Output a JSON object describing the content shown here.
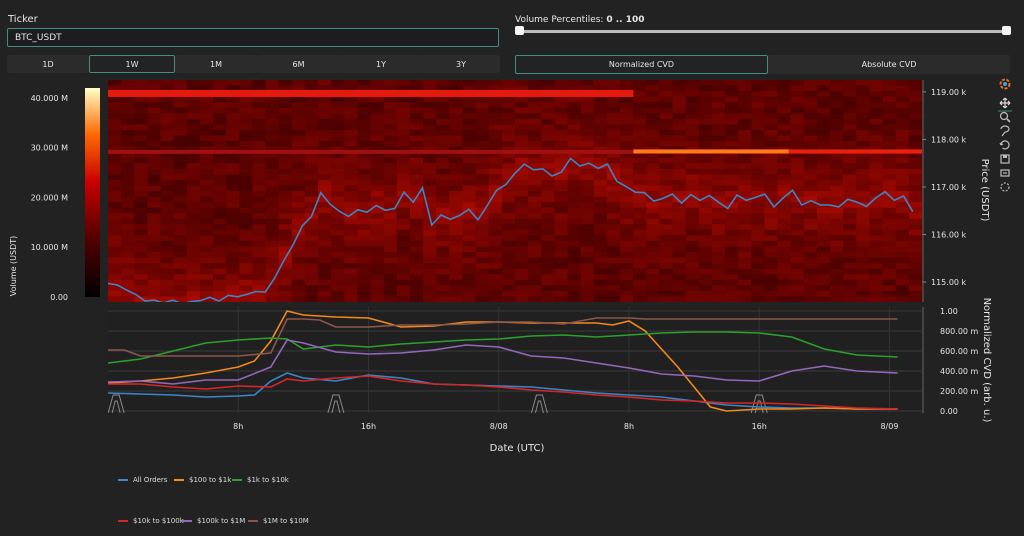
{
  "ticker": {
    "label": "Ticker",
    "value": "BTC_USDT"
  },
  "volume_filter": {
    "label": "Volume Percentiles:",
    "value": "0 .. 100",
    "low": 0,
    "high": 100
  },
  "timeframes": [
    {
      "label": "1D",
      "active": false
    },
    {
      "label": "1W",
      "active": true
    },
    {
      "label": "1M",
      "active": false
    },
    {
      "label": "6M",
      "active": false
    },
    {
      "label": "1Y",
      "active": false
    },
    {
      "label": "3Y",
      "active": false
    }
  ],
  "cvd_modes": [
    {
      "label": "Normalized CVD",
      "active": true
    },
    {
      "label": "Absolute CVD",
      "active": false
    }
  ],
  "toolbar_icons": [
    "plotly-logo-icon",
    "pan-icon",
    "zoom-icon",
    "lasso-icon",
    "reset-axes-icon",
    "download-icon",
    "autoscale-icon",
    "spike-lines-icon"
  ],
  "colors": {
    "accent": "#3f8e82",
    "price_line": "#3a86c8"
  },
  "chart_data": [
    {
      "type": "heatmap",
      "title": "",
      "xlabel": "",
      "ylabel": "Price (USDT)",
      "colorbar_title": "Volume (USDT)",
      "colorbar_ticks": [
        "40.000 M",
        "30.000 M",
        "20.000 M",
        "10.000 M",
        "0.00"
      ],
      "colorbar_range": [
        0,
        42000000
      ],
      "y_ticks": [
        "119.00 k",
        "118.00 k",
        "117.00 k",
        "116.00 k",
        "115.00 k"
      ],
      "y_tick_values": [
        119000,
        118000,
        117000,
        116000,
        115000
      ],
      "ylim": [
        114580,
        119250
      ],
      "x_hours": [
        0,
        44
      ],
      "price_series": {
        "hours": [
          0,
          0.5,
          1,
          1.5,
          2,
          2.5,
          3,
          3.5,
          4,
          4.5,
          5,
          5.5,
          6,
          6.5,
          7,
          7.5,
          8,
          8.5,
          9,
          9.5,
          10,
          10.5,
          11,
          11.5,
          12,
          12.5,
          13,
          13.5,
          14,
          14.5,
          15,
          15.5,
          16,
          16.5,
          17,
          17.5,
          18,
          18.5,
          19,
          19.5,
          20,
          20.5,
          21,
          21.5,
          22,
          22.5,
          23,
          23.5,
          24,
          24.5,
          25,
          25.5,
          26,
          26.5,
          27,
          27.5,
          28,
          28.5,
          29,
          29.5,
          30,
          30.5,
          31,
          31.5,
          32,
          32.5,
          33,
          33.5,
          34,
          34.5,
          35,
          35.5,
          36,
          36.5,
          37,
          37.5,
          38,
          38.5,
          39,
          39.5,
          40,
          40.5,
          41,
          41.5,
          42,
          42.5,
          43,
          43.5
        ],
        "values": [
          114970,
          114940,
          114830,
          114740,
          114600,
          114620,
          114560,
          114620,
          114540,
          114590,
          114610,
          114680,
          114600,
          114720,
          114690,
          114740,
          114800,
          114790,
          115080,
          115450,
          115780,
          116180,
          116380,
          116880,
          116640,
          116490,
          116380,
          116520,
          116470,
          116610,
          116510,
          116550,
          116890,
          116680,
          116980,
          116200,
          116410,
          116320,
          116400,
          116530,
          116310,
          116610,
          116930,
          117050,
          117290,
          117480,
          117360,
          117380,
          117230,
          117310,
          117600,
          117440,
          117500,
          117390,
          117480,
          117120,
          117010,
          116890,
          116880,
          116700,
          116760,
          116850,
          116660,
          116840,
          116720,
          116820,
          116680,
          116550,
          116830,
          116720,
          116780,
          116850,
          116580,
          116770,
          116930,
          116620,
          116710,
          116620,
          116620,
          116580,
          116740,
          116680,
          116590,
          116770,
          116900,
          116720,
          116810,
          116480
        ]
      }
    },
    {
      "type": "line",
      "title": "",
      "xlabel": "Date (UTC)",
      "ylabel": "Normalized CVD (arb. u.)",
      "x_ticks": [
        "8h",
        "16h",
        "8/08",
        "8h",
        "16h",
        "8/09"
      ],
      "x_tick_hours": [
        8,
        16,
        24,
        32,
        40,
        48
      ],
      "x_hours": [
        0,
        50
      ],
      "y_ticks": [
        "1.00",
        "800.00 m",
        "600.00 m",
        "400.00 m",
        "200.00 m",
        "0.00"
      ],
      "y_tick_values": [
        1.0,
        0.8,
        0.6,
        0.4,
        0.2,
        0.0
      ],
      "ylim": [
        -0.02,
        1.04
      ],
      "grid": true,
      "legend_position": "bottom",
      "series": [
        {
          "name": "All Orders",
          "color": "#3a86c8",
          "x": [
            0,
            2,
            4,
            6,
            8,
            9,
            10,
            11,
            12,
            14,
            16,
            18,
            20,
            22,
            24,
            26,
            28,
            30,
            32,
            34,
            36,
            38,
            40,
            42,
            44,
            46,
            48.5
          ],
          "y": [
            0.18,
            0.17,
            0.16,
            0.14,
            0.15,
            0.16,
            0.3,
            0.38,
            0.33,
            0.3,
            0.36,
            0.33,
            0.27,
            0.26,
            0.25,
            0.24,
            0.21,
            0.18,
            0.16,
            0.14,
            0.1,
            0.06,
            0.04,
            0.03,
            0.03,
            0.02,
            0.02
          ]
        },
        {
          "name": "$100 to $1k",
          "color": "#f2891b",
          "x": [
            0,
            2,
            4,
            6,
            8,
            9,
            10,
            11,
            12,
            14,
            16,
            18,
            20,
            22,
            24,
            26,
            28,
            30,
            31,
            32,
            33,
            34,
            35,
            36,
            37,
            38,
            40,
            42,
            44,
            46,
            48.5
          ],
          "y": [
            0.28,
            0.3,
            0.33,
            0.38,
            0.44,
            0.5,
            0.7,
            1.0,
            0.96,
            0.94,
            0.93,
            0.84,
            0.85,
            0.89,
            0.89,
            0.88,
            0.88,
            0.88,
            0.86,
            0.9,
            0.8,
            0.62,
            0.44,
            0.24,
            0.04,
            0.0,
            0.02,
            0.02,
            0.03,
            0.02,
            0.02
          ]
        },
        {
          "name": "$1k to $10k",
          "color": "#2ca02c",
          "x": [
            0,
            2,
            4,
            6,
            8,
            10,
            11,
            12,
            14,
            16,
            18,
            20,
            22,
            24,
            26,
            28,
            30,
            32,
            34,
            36,
            38,
            40,
            42,
            44,
            46,
            48.5
          ],
          "y": [
            0.48,
            0.52,
            0.6,
            0.68,
            0.71,
            0.73,
            0.72,
            0.62,
            0.66,
            0.64,
            0.67,
            0.69,
            0.71,
            0.72,
            0.75,
            0.76,
            0.74,
            0.76,
            0.78,
            0.79,
            0.79,
            0.78,
            0.74,
            0.62,
            0.56,
            0.54
          ]
        },
        {
          "name": "$10k to $100k",
          "color": "#d62728",
          "x": [
            0,
            2,
            4,
            6,
            8,
            10,
            11,
            12,
            14,
            16,
            18,
            20,
            22,
            24,
            26,
            28,
            30,
            32,
            34,
            36,
            38,
            40,
            42,
            44,
            46,
            48.5
          ],
          "y": [
            0.27,
            0.27,
            0.24,
            0.22,
            0.25,
            0.24,
            0.32,
            0.3,
            0.33,
            0.35,
            0.3,
            0.27,
            0.26,
            0.24,
            0.21,
            0.19,
            0.16,
            0.14,
            0.11,
            0.1,
            0.08,
            0.08,
            0.07,
            0.05,
            0.03,
            0.02
          ]
        },
        {
          "name": "$100k to $1M",
          "color": "#9467bd",
          "x": [
            0,
            2,
            4,
            6,
            8,
            10,
            11,
            12,
            14,
            16,
            18,
            20,
            22,
            24,
            26,
            28,
            30,
            32,
            34,
            36,
            38,
            40,
            42,
            44,
            46,
            48.5
          ],
          "y": [
            0.29,
            0.3,
            0.27,
            0.31,
            0.31,
            0.44,
            0.71,
            0.68,
            0.59,
            0.57,
            0.58,
            0.61,
            0.66,
            0.64,
            0.55,
            0.53,
            0.48,
            0.43,
            0.37,
            0.35,
            0.31,
            0.3,
            0.4,
            0.45,
            0.4,
            0.38
          ]
        },
        {
          "name": "$1M to $10M",
          "color": "#8c564b",
          "x": [
            0,
            1,
            2,
            3,
            4,
            5,
            6,
            7,
            8,
            10,
            11,
            12,
            13,
            14,
            16,
            18,
            20,
            22,
            24,
            26,
            28,
            30,
            32,
            33,
            34,
            36,
            40,
            44,
            48.5
          ],
          "y": [
            0.61,
            0.61,
            0.55,
            0.55,
            0.55,
            0.55,
            0.55,
            0.55,
            0.55,
            0.58,
            0.92,
            0.92,
            0.91,
            0.84,
            0.84,
            0.86,
            0.86,
            0.87,
            0.89,
            0.89,
            0.87,
            0.93,
            0.93,
            0.92,
            0.92,
            0.92,
            0.92,
            0.92,
            0.92
          ]
        }
      ]
    }
  ]
}
